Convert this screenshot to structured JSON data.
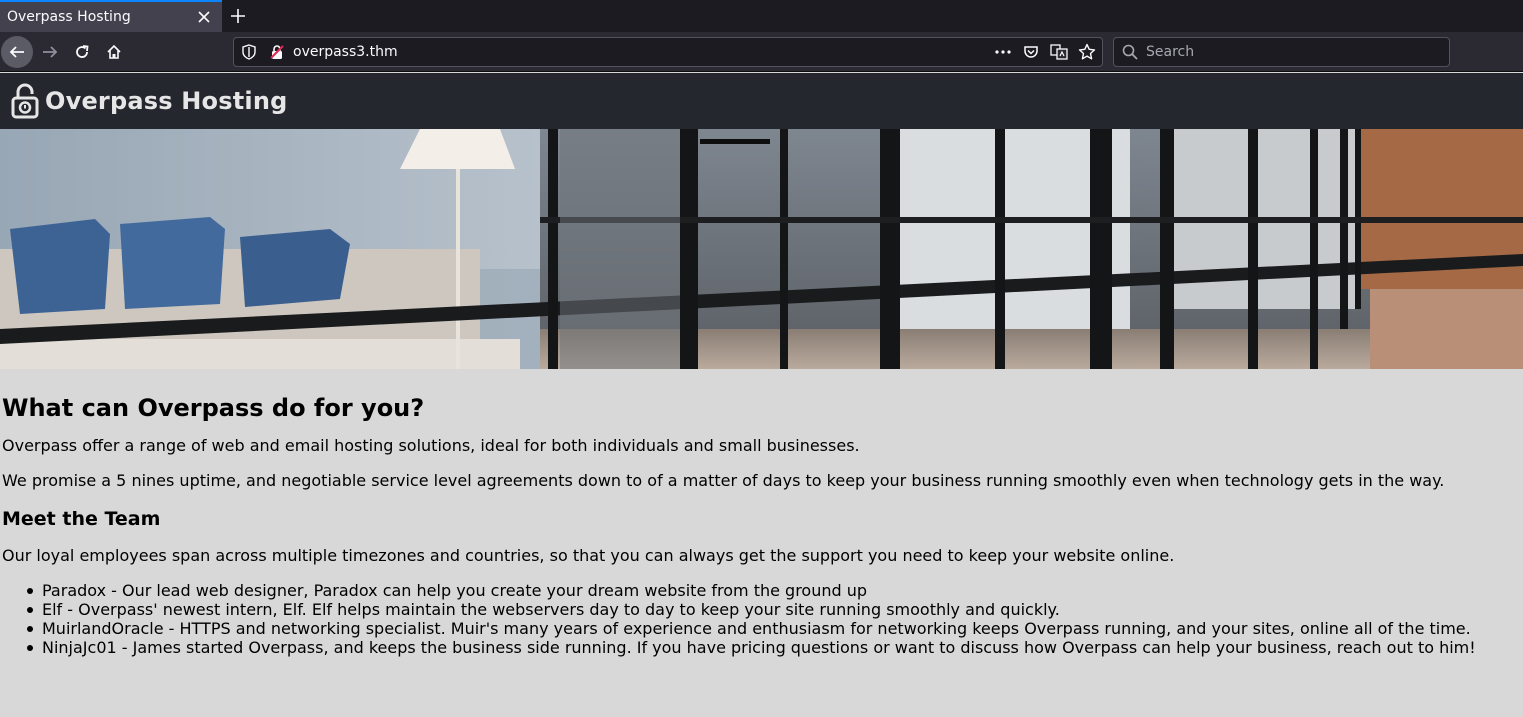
{
  "browser": {
    "tab_title": "Overpass Hosting",
    "url": "overpass3.thm",
    "search_placeholder": "Search",
    "accent_color": "#0a84ff"
  },
  "site": {
    "title": "Overpass Hosting",
    "header_bg": "#24272d",
    "page_bg": "#d8d8d8"
  },
  "main": {
    "heading": "What can Overpass do for you?",
    "intro": "Overpass offer a range of web and email hosting solutions, ideal for both individuals and small businesses.",
    "promise": "We promise a 5 nines uptime, and negotiable service level agreements down to of a matter of days to keep your business running smoothly even when technology gets in the way.",
    "team_heading": "Meet the Team",
    "team_intro": "Our loyal employees span across multiple timezones and countries, so that you can always get the support you need to keep your website online.",
    "team": [
      "Paradox - Our lead web designer, Paradox can help you create your dream website from the ground up",
      "Elf - Overpass' newest intern, Elf. Elf helps maintain the webservers day to day to keep your site running smoothly and quickly.",
      "MuirlandOracle - HTTPS and networking specialist. Muir's many years of experience and enthusiasm for networking keeps Overpass running, and your sites, online all of the time.",
      "NinjaJc01 - James started Overpass, and keeps the business side running. If you have pricing questions or want to discuss how Overpass can help your business, reach out to him!"
    ]
  }
}
